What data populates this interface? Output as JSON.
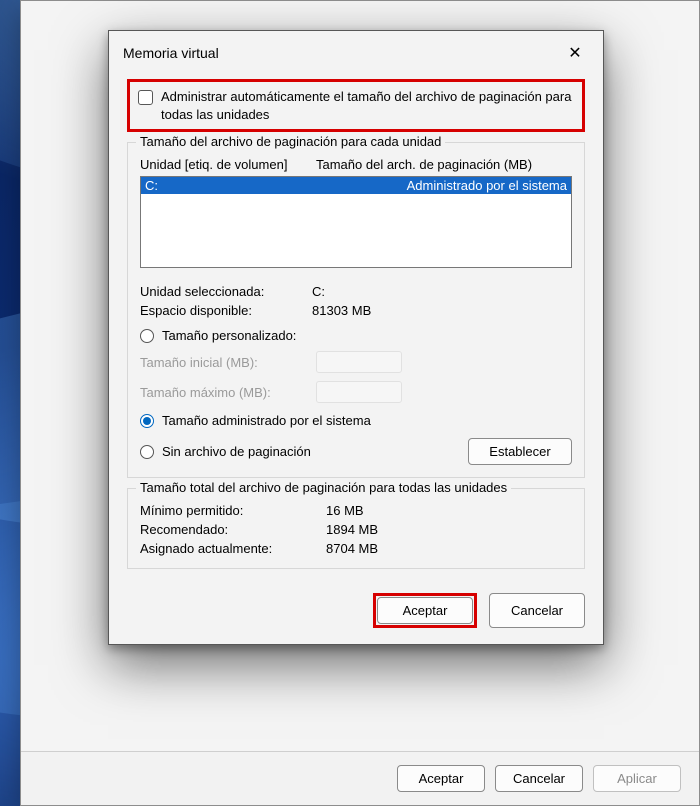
{
  "dialog": {
    "title": "Memoria virtual",
    "auto_manage_label": "Administrar automáticamente el tamaño del archivo de paginación para todas las unidades",
    "auto_manage_checked": false,
    "per_drive_group": {
      "legend": "Tamaño del archivo de paginación para cada unidad",
      "header_drive": "Unidad [etiq. de volumen]",
      "header_size": "Tamaño del arch. de paginación (MB)",
      "rows": [
        {
          "drive": "C:",
          "size": "Administrado por el sistema",
          "selected": true
        }
      ],
      "selected_drive_label": "Unidad seleccionada:",
      "selected_drive_value": "C:",
      "free_space_label": "Espacio disponible:",
      "free_space_value": "81303 MB",
      "custom_size_label": "Tamaño personalizado:",
      "initial_label": "Tamaño inicial (MB):",
      "max_label": "Tamaño máximo (MB):",
      "system_managed_label": "Tamaño administrado por el sistema",
      "no_paging_label": "Sin archivo de paginación",
      "set_button": "Establecer",
      "selected_option": "system"
    },
    "totals_group": {
      "legend": "Tamaño total del archivo de paginación para todas las unidades",
      "min_label": "Mínimo permitido:",
      "min_value": "16 MB",
      "rec_label": "Recomendado:",
      "rec_value": "1894 MB",
      "cur_label": "Asignado actualmente:",
      "cur_value": "8704 MB"
    },
    "ok": "Aceptar",
    "cancel": "Cancelar"
  },
  "behind": {
    "ok": "Aceptar",
    "cancel": "Cancelar",
    "apply": "Aplicar"
  }
}
